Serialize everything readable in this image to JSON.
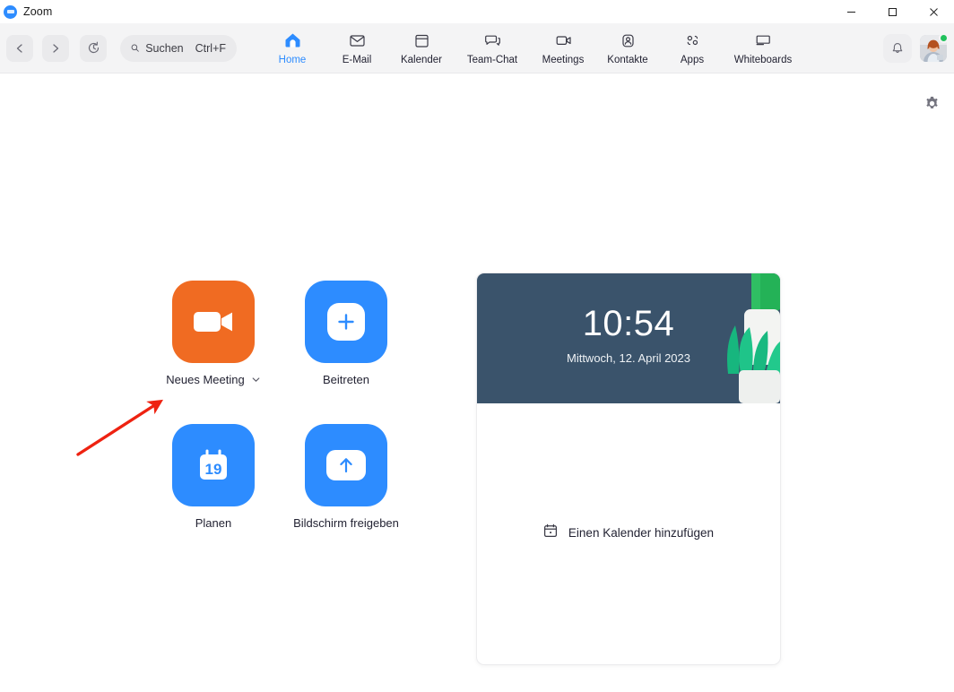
{
  "window": {
    "app_title": "Zoom",
    "logo_icon": "zoom-logo",
    "minimize_label": "—",
    "maximize_label": "☐",
    "close_label": "✕"
  },
  "toolbar": {
    "back_icon": "chevron-left-icon",
    "forward_icon": "chevron-right-icon",
    "history_icon": "history-clock-icon",
    "search": {
      "icon": "search-icon",
      "placeholder": "Suchen",
      "shortcut": "Ctrl+F"
    },
    "tabs": [
      {
        "label": "Home",
        "icon": "home-icon",
        "active": true
      },
      {
        "label": "E-Mail",
        "icon": "mail-icon",
        "active": false
      },
      {
        "label": "Kalender",
        "icon": "calendar-icon",
        "active": false
      },
      {
        "label": "Team-Chat",
        "icon": "chat-bubble-icon",
        "active": false
      },
      {
        "label": "Meetings",
        "icon": "video-camera-icon",
        "active": false
      },
      {
        "label": "Kontakte",
        "icon": "person-icon",
        "active": false
      },
      {
        "label": "Apps",
        "icon": "apps-icon",
        "active": false
      },
      {
        "label": "Whiteboards",
        "icon": "whiteboard-icon",
        "active": false
      }
    ],
    "notifications_icon": "bell-icon",
    "avatar_icon": "user-avatar",
    "status": "available",
    "status_color": "#20c15c"
  },
  "content": {
    "settings_icon": "gear-icon",
    "actions": [
      {
        "label": "Neues Meeting",
        "icon": "video-camera-icon",
        "color": "#f06b22",
        "has_dropdown": true,
        "dropdown_icon": "chevron-down-icon"
      },
      {
        "label": "Beitreten",
        "icon": "plus-icon",
        "color": "#2d8cff",
        "has_dropdown": false
      },
      {
        "label": "Planen",
        "icon": "calendar-19-icon",
        "color": "#2d8cff",
        "has_dropdown": false,
        "calendar_day": "19"
      },
      {
        "label": "Bildschirm freigeben",
        "icon": "share-screen-arrow-up-icon",
        "color": "#2d8cff",
        "has_dropdown": false
      }
    ],
    "card": {
      "clock": {
        "time": "10:54",
        "date": "Mittwoch, 12. April 2023",
        "background_color": "#3a536b",
        "decoration_icon": "potted-plant-illustration"
      },
      "add_calendar": {
        "icon": "calendar-icon",
        "label": "Einen Kalender hinzufügen"
      }
    },
    "annotation": {
      "arrow_icon": "red-arrow-icon",
      "arrow_color": "#ee2211"
    }
  }
}
